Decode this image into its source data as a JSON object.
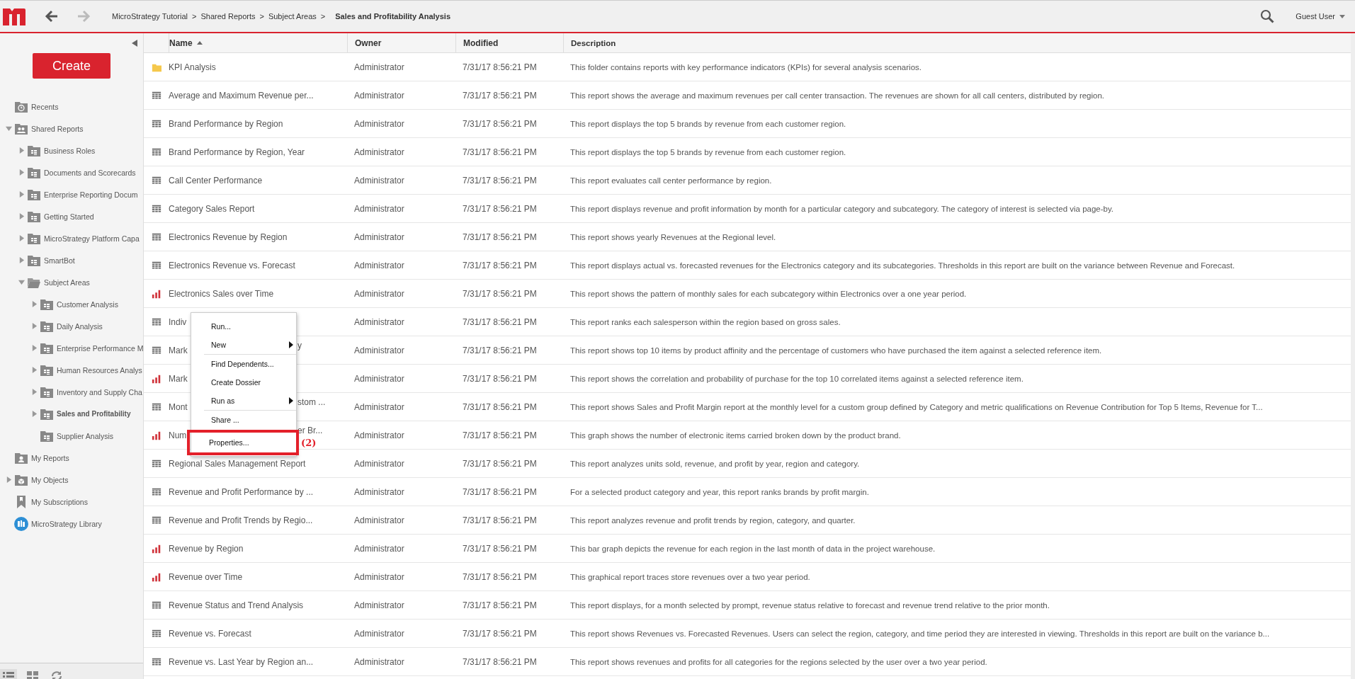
{
  "header": {
    "breadcrumbs": [
      {
        "label": "MicroStrategy Tutorial",
        "separator": ">",
        "current": false
      },
      {
        "label": "Shared Reports",
        "separator": ">",
        "current": false
      },
      {
        "label": "Subject Areas",
        "separator": ">",
        "current": false
      },
      {
        "label": "Sales and Profitability Analysis",
        "current": true
      }
    ],
    "user": "Guest User"
  },
  "sidebar": {
    "create_button": "Create",
    "tree": [
      {
        "label": "Recents",
        "kind": "recents",
        "selected": false
      },
      {
        "label": "Shared Reports",
        "kind": "shared",
        "expanded": true,
        "selected": false,
        "children": [
          {
            "label": "Business Roles",
            "kind": "folder",
            "expanded": false,
            "selected": false
          },
          {
            "label": "Documents and Scorecards",
            "kind": "folder",
            "expanded": false,
            "selected": false
          },
          {
            "label": "Enterprise Reporting Docum",
            "kind": "folder",
            "expanded": false,
            "selected": false
          },
          {
            "label": "Getting Started",
            "kind": "folder",
            "expanded": false,
            "selected": false
          },
          {
            "label": "MicroStrategy Platform Capa",
            "kind": "folder",
            "expanded": false,
            "selected": false
          },
          {
            "label": "SmartBot",
            "kind": "folder",
            "expanded": false,
            "selected": false
          },
          {
            "label": "Subject Areas",
            "kind": "open-folder",
            "expanded": true,
            "selected": false,
            "children": [
              {
                "label": "Customer Analysis",
                "kind": "folder",
                "expanded": false,
                "selected": false
              },
              {
                "label": "Daily Analysis",
                "kind": "folder",
                "expanded": false,
                "selected": false
              },
              {
                "label": "Enterprise Performance M",
                "kind": "folder",
                "expanded": false,
                "selected": false
              },
              {
                "label": "Human Resources Analys",
                "kind": "folder",
                "expanded": false,
                "selected": false
              },
              {
                "label": "Inventory and Supply Cha",
                "kind": "folder",
                "expanded": false,
                "selected": false
              },
              {
                "label": "Sales and Profitability",
                "kind": "folder",
                "expanded": false,
                "selected": true
              },
              {
                "label": "Supplier Analysis",
                "kind": "folder",
                "selected": false
              }
            ]
          }
        ]
      },
      {
        "label": "My Reports",
        "kind": "user",
        "selected": false
      },
      {
        "label": "My Objects",
        "kind": "objects",
        "expanded": false,
        "selected": false
      },
      {
        "label": "My Subscriptions",
        "kind": "subscriptions",
        "selected": false
      },
      {
        "label": "MicroStrategy Library",
        "kind": "library",
        "selected": false
      }
    ]
  },
  "table": {
    "columns": [
      {
        "label": "Name",
        "sorted": true
      },
      {
        "label": "Owner",
        "sorted": false
      },
      {
        "label": "Modified",
        "sorted": false
      },
      {
        "label": "Description",
        "sorted": false
      }
    ],
    "rows": [
      {
        "kind": "folder",
        "name": "KPI Analysis",
        "owner": "Administrator",
        "modified": "7/31/17 8:56:21 PM",
        "description": "This folder contains reports with key performance indicators (KPIs) for several analysis scenarios."
      },
      {
        "kind": "grid",
        "name": "Average and Maximum Revenue per...",
        "owner": "Administrator",
        "modified": "7/31/17 8:56:21 PM",
        "description": "This report shows the average and maximum revenues per call center transaction.  The revenues are shown for all call centers, distributed by region."
      },
      {
        "kind": "grid",
        "name": "Brand Performance by Region",
        "owner": "Administrator",
        "modified": "7/31/17 8:56:21 PM",
        "description": "This report displays the top 5 brands by revenue from each customer region."
      },
      {
        "kind": "grid",
        "name": "Brand Performance by Region, Year",
        "owner": "Administrator",
        "modified": "7/31/17 8:56:21 PM",
        "description": "This report displays the top 5 brands by revenue from each customer region."
      },
      {
        "kind": "grid",
        "name": "Call Center Performance",
        "owner": "Administrator",
        "modified": "7/31/17 8:56:21 PM",
        "description": "This report evaluates call center performance by region."
      },
      {
        "kind": "grid",
        "name": "Category Sales Report",
        "owner": "Administrator",
        "modified": "7/31/17 8:56:21 PM",
        "description": "This report displays revenue and profit information by month for a particular category and subcategory.  The category of interest is selected via page-by."
      },
      {
        "kind": "grid",
        "name": "Electronics Revenue by Region",
        "owner": "Administrator",
        "modified": "7/31/17 8:56:21 PM",
        "description": "This report shows yearly Revenues at the Regional level."
      },
      {
        "kind": "grid",
        "name": "Electronics Revenue vs. Forecast",
        "owner": "Administrator",
        "modified": "7/31/17 8:56:21 PM",
        "description": "This report displays actual vs. forecasted revenues for the Electronics category and its subcategories. Thresholds in this report are built on the variance between Revenue and Forecast."
      },
      {
        "kind": "chart",
        "name": "Electronics Sales over Time",
        "owner": "Administrator",
        "modified": "7/31/17 8:56:21 PM",
        "description": "This report shows the pattern of monthly sales for each subcategory within Electronics over a one year period."
      },
      {
        "kind": "grid",
        "name": "Indiv",
        "owner": "Administrator",
        "modified": "7/31/17 8:56:21 PM",
        "description": "This report ranks each salesperson within the region based on gross sales."
      },
      {
        "kind": "grid",
        "name": "Mark",
        "name_tail": "y",
        "owner": "Administrator",
        "modified": "7/31/17 8:56:21 PM",
        "description": "This report shows top 10 items by product affinity and the percentage of customers who have purchased the item against a selected reference item."
      },
      {
        "kind": "chart",
        "name": "Mark",
        "owner": "Administrator",
        "modified": "7/31/17 8:56:21 PM",
        "description": "This report shows the correlation and probability of purchase for the top 10 correlated items against a selected reference item."
      },
      {
        "kind": "grid",
        "name": "Mont",
        "name_tail": "stom ...",
        "owner": "Administrator",
        "modified": "7/31/17 8:56:21 PM",
        "description": "This report shows Sales and Profit Margin report at the monthly level for a custom group defined by Category and metric qualifications on Revenue Contribution for Top 5 Items, Revenue for T..."
      },
      {
        "kind": "chart",
        "name": "Num",
        "name_tail": "er Br...",
        "owner": "Administrator",
        "modified": "7/31/17 8:56:21 PM",
        "description": "This graph shows the number of electronic items carried broken down by the product brand."
      },
      {
        "kind": "grid",
        "name": "Regional Sales Management Report",
        "owner": "Administrator",
        "modified": "7/31/17 8:56:21 PM",
        "description": "This report analyzes units sold, revenue, and profit by year, region and category."
      },
      {
        "kind": "grid",
        "name": "Revenue and Profit Performance by ...",
        "owner": "Administrator",
        "modified": "7/31/17 8:56:21 PM",
        "description": "For a selected product category and year, this report ranks brands by profit margin."
      },
      {
        "kind": "grid",
        "name": "Revenue and Profit Trends by Regio...",
        "owner": "Administrator",
        "modified": "7/31/17 8:56:21 PM",
        "description": "This report analyzes revenue and profit trends by region, category, and quarter."
      },
      {
        "kind": "chart",
        "name": "Revenue by Region",
        "owner": "Administrator",
        "modified": "7/31/17 8:56:21 PM",
        "description": "This bar graph depicts the revenue for each region in the last month of data in the project warehouse."
      },
      {
        "kind": "chart",
        "name": "Revenue over Time",
        "owner": "Administrator",
        "modified": "7/31/17 8:56:21 PM",
        "description": "This graphical report traces store revenues over a two year period."
      },
      {
        "kind": "grid",
        "name": "Revenue Status and Trend Analysis",
        "owner": "Administrator",
        "modified": "7/31/17 8:56:21 PM",
        "description": "This report displays, for a month selected by prompt, revenue status relative to forecast and revenue trend relative to the prior month."
      },
      {
        "kind": "grid",
        "name": "Revenue vs. Forecast",
        "owner": "Administrator",
        "modified": "7/31/17 8:56:21 PM",
        "description": "This report shows Revenues vs. Forecasted Revenues. Users can select the region, category, and time period they are interested in viewing. Thresholds in this report are built on the variance b..."
      },
      {
        "kind": "grid",
        "name": "Revenue vs. Last Year by Region an...",
        "owner": "Administrator",
        "modified": "7/31/17 8:56:21 PM",
        "description": "This report shows revenues and profits for all categories for the regions selected by the user over a two year period."
      }
    ]
  },
  "context_menu": {
    "items": [
      {
        "label": "Run...",
        "submenu": false,
        "highlighted": false
      },
      {
        "label": "New",
        "submenu": true,
        "highlighted": false,
        "divider_after": true
      },
      {
        "label": "Find Dependents...",
        "submenu": false,
        "highlighted": false
      },
      {
        "label": "Create Dossier",
        "submenu": false,
        "highlighted": false
      },
      {
        "label": "Run as",
        "submenu": true,
        "highlighted": false,
        "divider_after": true
      },
      {
        "label": "Share ...",
        "submenu": false,
        "highlighted": false
      },
      {
        "label": "Properties...",
        "submenu": false,
        "highlighted": true,
        "annotation": "(2)"
      }
    ]
  }
}
